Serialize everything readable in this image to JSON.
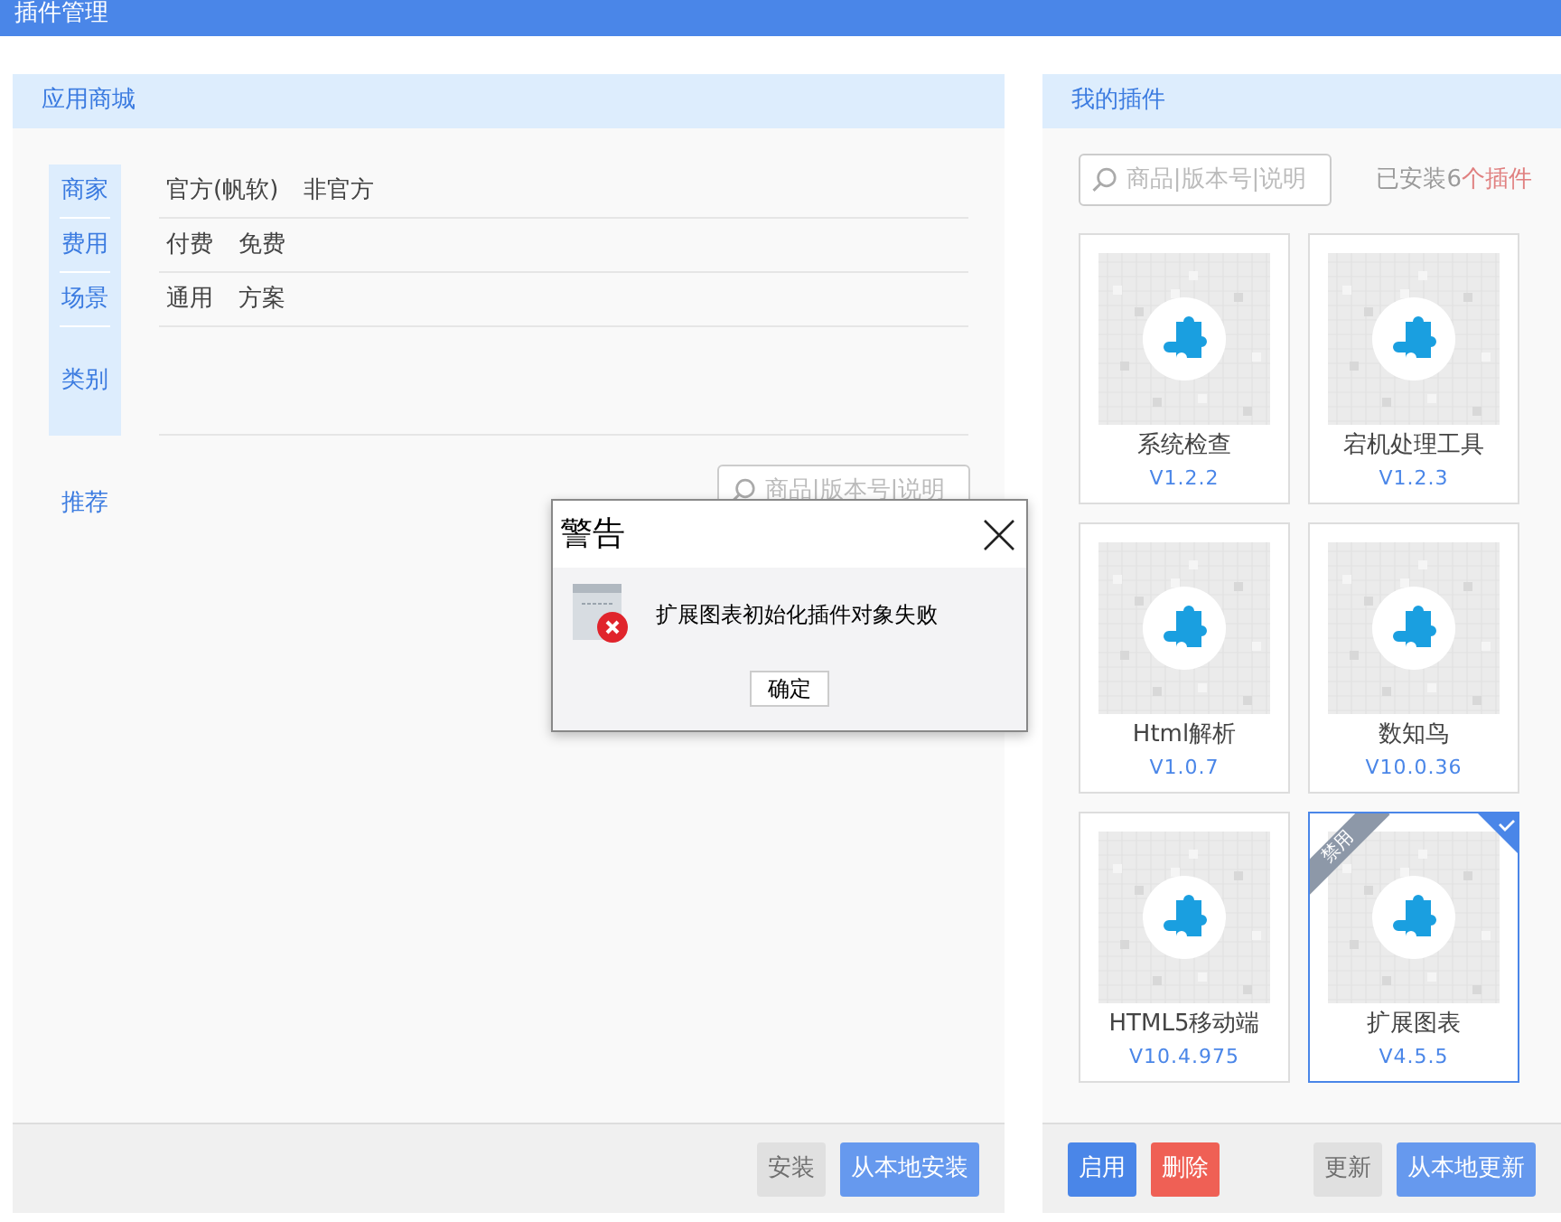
{
  "title": "插件管理",
  "store": {
    "title": "应用商城",
    "filters": [
      {
        "label": "商家",
        "options": [
          "官方(帆软)",
          "非官方"
        ]
      },
      {
        "label": "费用",
        "options": [
          "付费",
          "免费"
        ]
      },
      {
        "label": "场景",
        "options": [
          "通用",
          "方案"
        ]
      },
      {
        "label": "类别"
      }
    ],
    "recommend": "推荐",
    "search": {
      "placeholder": "商品|版本号|说明"
    },
    "buttons": [
      {
        "label": "安装",
        "kind": "primary",
        "disabled": true
      },
      {
        "label": "从本地安装",
        "kind": "primary",
        "disabled": false
      }
    ]
  },
  "mine": {
    "title": "我的插件",
    "search": {
      "placeholder": "商品|版本号|说明"
    },
    "count": {
      "text": "已安装6",
      "highlight": "个插件"
    },
    "plugins": [
      {
        "name": "系统检查",
        "version": "V1.2.2",
        "selected": false
      },
      {
        "name": "宕机处理工具",
        "version": "V1.2.3",
        "selected": false
      },
      {
        "name": "Html解析",
        "version": "V1.0.7",
        "selected": false
      },
      {
        "name": "数知鸟",
        "version": "V10.0.36",
        "selected": false
      },
      {
        "name": "HTML5移动端",
        "version": "V10.4.975",
        "selected": false
      },
      {
        "name": "扩展图表",
        "version": "V4.5.5",
        "selected": true,
        "ribbon": "禁用"
      }
    ],
    "left_buttons": [
      {
        "label": "启用",
        "kind": "primary",
        "disabled": false
      },
      {
        "label": "删除",
        "kind": "danger",
        "disabled": false
      }
    ],
    "right_buttons": [
      {
        "label": "更新",
        "kind": "primary",
        "disabled": true
      },
      {
        "label": "从本地更新",
        "kind": "primary",
        "disabled": false
      }
    ]
  },
  "dialog": {
    "title": "警告",
    "message": "扩展图表初始化插件对象失败",
    "button": "确定"
  }
}
